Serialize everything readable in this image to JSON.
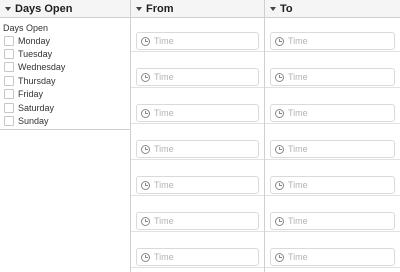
{
  "header": {
    "col1": "Days Open",
    "col2": "From",
    "col3": "To"
  },
  "days_group": {
    "label": "Days Open",
    "days": [
      "Monday",
      "Tuesday",
      "Wednesday",
      "Thursday",
      "Friday",
      "Saturday",
      "Sunday"
    ]
  },
  "time_field": {
    "placeholder": "Time",
    "icon": "clock-icon"
  },
  "rows": 7
}
